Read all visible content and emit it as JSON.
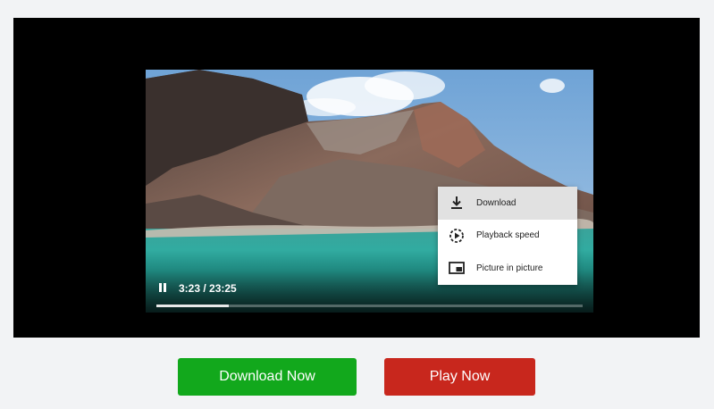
{
  "player": {
    "current_time": "3:23",
    "duration": "23:25",
    "time_display": "3:23 / 23:25",
    "progress_fraction": 0.17
  },
  "menu": {
    "items": [
      {
        "label": "Download",
        "icon": "download-icon",
        "active": true
      },
      {
        "label": "Playback speed",
        "icon": "playback-speed-icon",
        "active": false
      },
      {
        "label": "Picture in picture",
        "icon": "picture-in-picture-icon",
        "active": false
      }
    ]
  },
  "buttons": {
    "download_label": "Download Now",
    "play_label": "Play Now"
  },
  "colors": {
    "download_button": "#12a81c",
    "play_button": "#c8271d",
    "page_background": "#f2f3f5"
  }
}
